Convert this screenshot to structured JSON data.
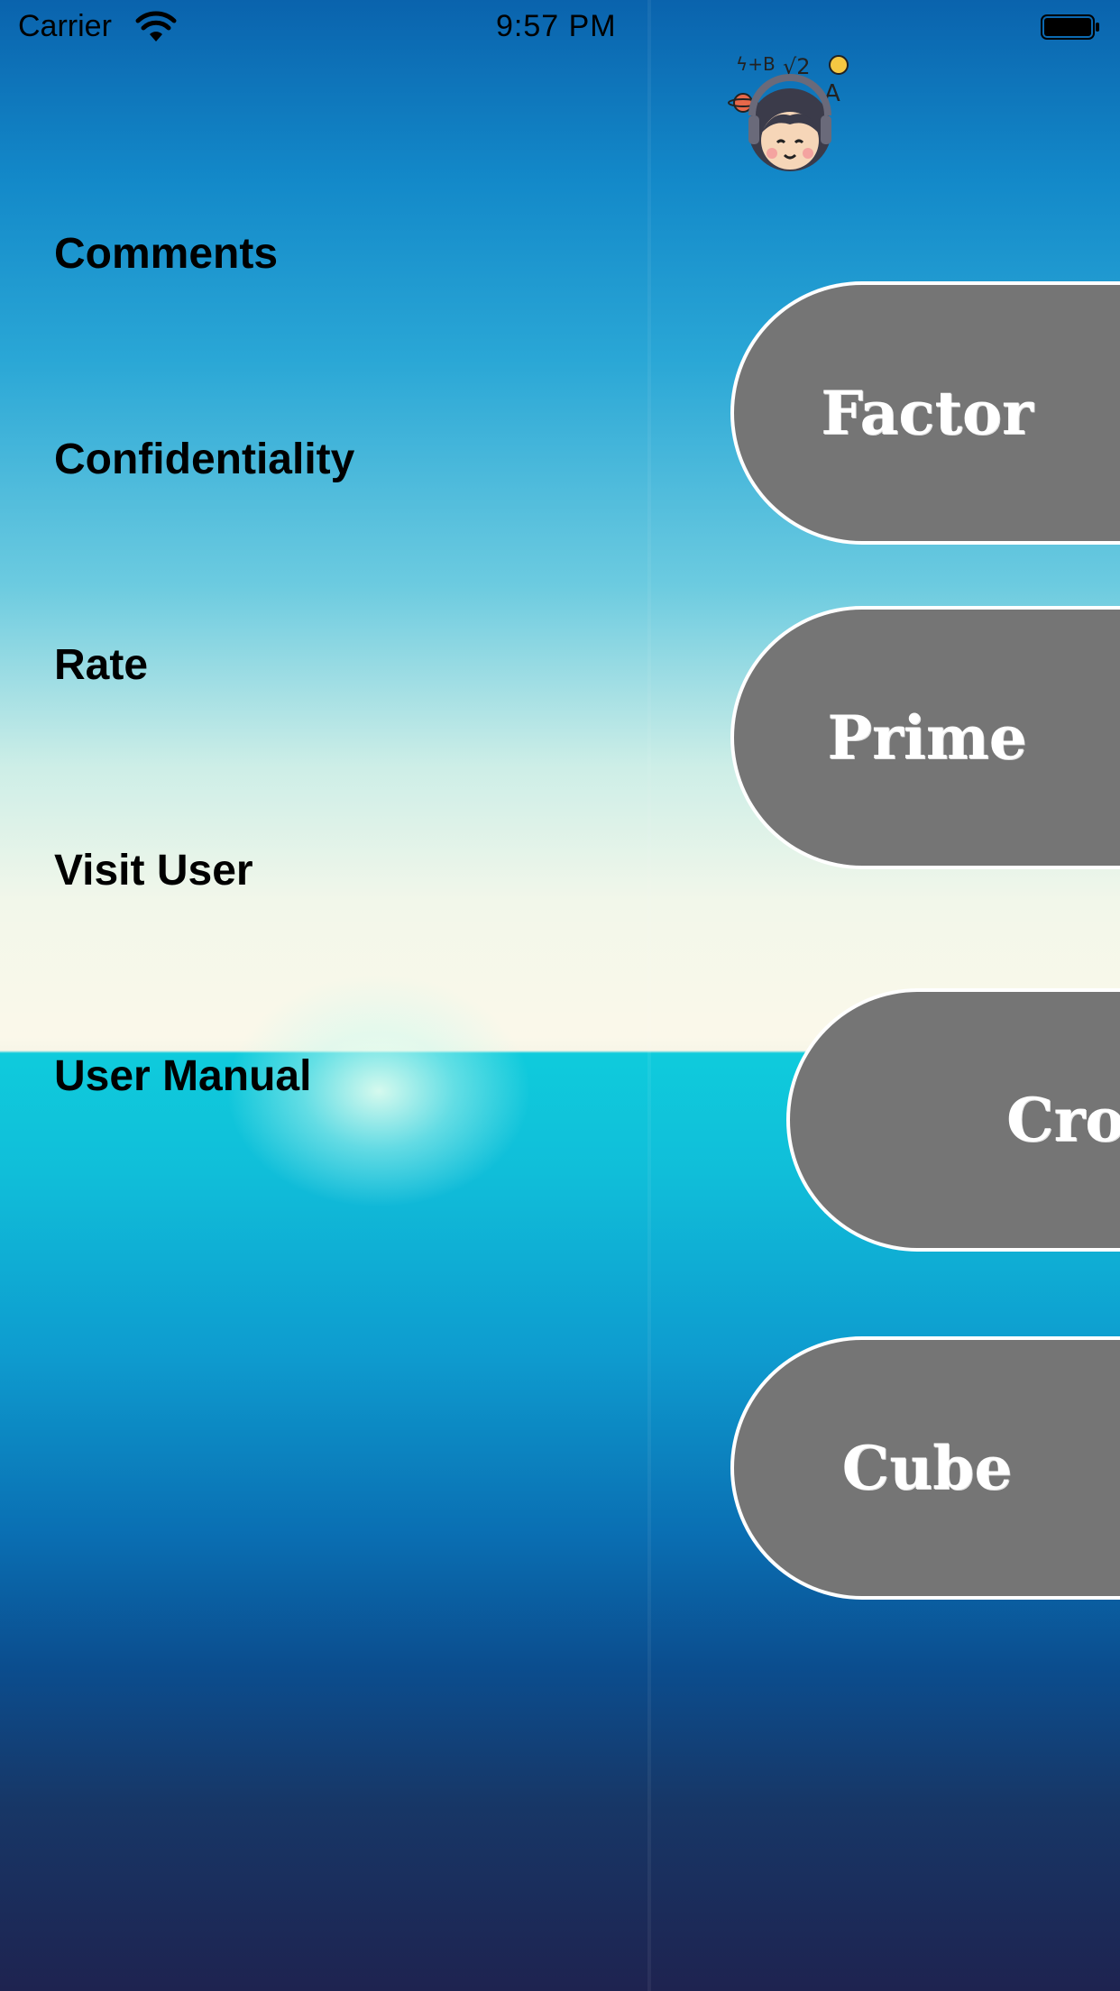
{
  "status_bar": {
    "carrier": "Carrier",
    "time": "9:57 PM",
    "icons": [
      "wifi-icon",
      "battery-icon"
    ]
  },
  "mascot": {
    "icon": "math-mascot-icon"
  },
  "menu": {
    "items": [
      {
        "label": "Comments"
      },
      {
        "label": "Confidentiality"
      },
      {
        "label": "Rate"
      },
      {
        "label": "Visit User"
      },
      {
        "label": "User Manual"
      }
    ]
  },
  "buttons": [
    {
      "label": "Factor"
    },
    {
      "label": "Prime"
    },
    {
      "label": "Cros"
    },
    {
      "label": "Cube"
    }
  ],
  "colors": {
    "button_fill": "#757575",
    "button_border": "#ffffff",
    "menu_text": "#000000"
  }
}
